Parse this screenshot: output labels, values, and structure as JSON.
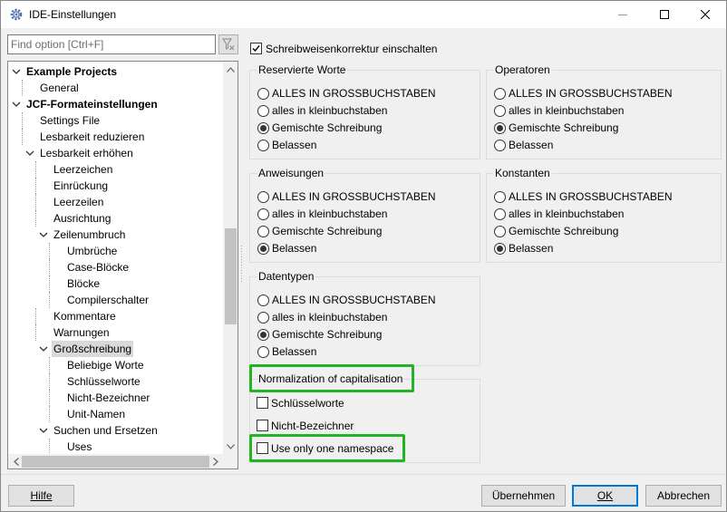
{
  "window": {
    "title": "IDE-Einstellungen",
    "icon": "gear-icon"
  },
  "search": {
    "placeholder": "Find option [Ctrl+F]",
    "value": ""
  },
  "tree": [
    {
      "label": "Example Projects",
      "bold": true,
      "expanded": true,
      "depth": 0
    },
    {
      "label": "General",
      "depth": 1
    },
    {
      "label": "JCF-Formateinstellungen",
      "bold": true,
      "expanded": true,
      "depth": 0
    },
    {
      "label": "Settings File",
      "depth": 1
    },
    {
      "label": "Lesbarkeit reduzieren",
      "depth": 1
    },
    {
      "label": "Lesbarkeit erhöhen",
      "expanded": true,
      "depth": 1
    },
    {
      "label": "Leerzeichen",
      "depth": 2
    },
    {
      "label": "Einrückung",
      "depth": 2
    },
    {
      "label": "Leerzeilen",
      "depth": 2
    },
    {
      "label": "Ausrichtung",
      "depth": 2
    },
    {
      "label": "Zeilenumbruch",
      "expanded": true,
      "depth": 2
    },
    {
      "label": "Umbrüche",
      "depth": 3
    },
    {
      "label": "Case-Blöcke",
      "depth": 3
    },
    {
      "label": "Blöcke",
      "depth": 3
    },
    {
      "label": "Compilerschalter",
      "depth": 3
    },
    {
      "label": "Kommentare",
      "depth": 2
    },
    {
      "label": "Warnungen",
      "depth": 2
    },
    {
      "label": "Großschreibung",
      "expanded": true,
      "selected": true,
      "depth": 2
    },
    {
      "label": "Beliebige Worte",
      "depth": 3
    },
    {
      "label": "Schlüsselworte",
      "depth": 3
    },
    {
      "label": "Nicht-Bezeichner",
      "depth": 3
    },
    {
      "label": "Unit-Namen",
      "depth": 3
    },
    {
      "label": "Suchen und Ersetzen",
      "expanded": true,
      "depth": 2
    },
    {
      "label": "Uses",
      "depth": 3
    }
  ],
  "main": {
    "enable_checkbox": {
      "label": "Schreibweisenkorrektur einschalten",
      "checked": true
    },
    "radio_options": [
      "ALLES IN GROSSBUCHSTABEN",
      "alles in kleinbuchstaben",
      "Gemischte Schreibung",
      "Belassen"
    ],
    "groups": [
      {
        "title": "Reservierte Worte",
        "selected": 2
      },
      {
        "title": "Operatoren",
        "selected": 2
      },
      {
        "title": "Anweisungen",
        "selected": 3
      },
      {
        "title": "Konstanten",
        "selected": 3
      },
      {
        "title": "Datentypen",
        "selected": 2
      }
    ],
    "normalization": {
      "title": "Normalization of capitalisation",
      "options": [
        {
          "label": "Schlüsselworte",
          "checked": false
        },
        {
          "label": "Nicht-Bezeichner",
          "checked": false
        },
        {
          "label": "Use only one namespace",
          "checked": false
        }
      ]
    }
  },
  "footer": {
    "help": "Hilfe",
    "apply": "Übernehmen",
    "ok": "OK",
    "cancel": "Abbrechen"
  },
  "colors": {
    "highlight": "#22b422",
    "accent": "#0078d7"
  }
}
